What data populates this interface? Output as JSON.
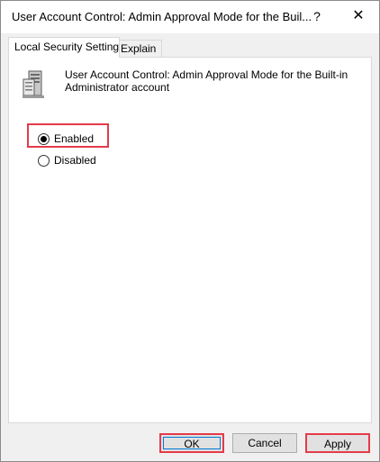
{
  "window": {
    "title": "User Account Control: Admin Approval Mode for the Buil...",
    "help_glyph": "?",
    "close_glyph": "✕"
  },
  "tabs": [
    {
      "label": "Local Security Setting",
      "active": true
    },
    {
      "label": "Explain",
      "active": false
    }
  ],
  "policy": {
    "icon": "server-policy-icon",
    "title": "User Account Control: Admin Approval Mode for the Built-in Administrator account"
  },
  "options": [
    {
      "label": "Enabled",
      "selected": true
    },
    {
      "label": "Disabled",
      "selected": false
    }
  ],
  "buttons": {
    "ok": "OK",
    "cancel": "Cancel",
    "apply": "Apply"
  },
  "colors": {
    "highlight": "#e43b4a",
    "focus": "#0078d7"
  }
}
